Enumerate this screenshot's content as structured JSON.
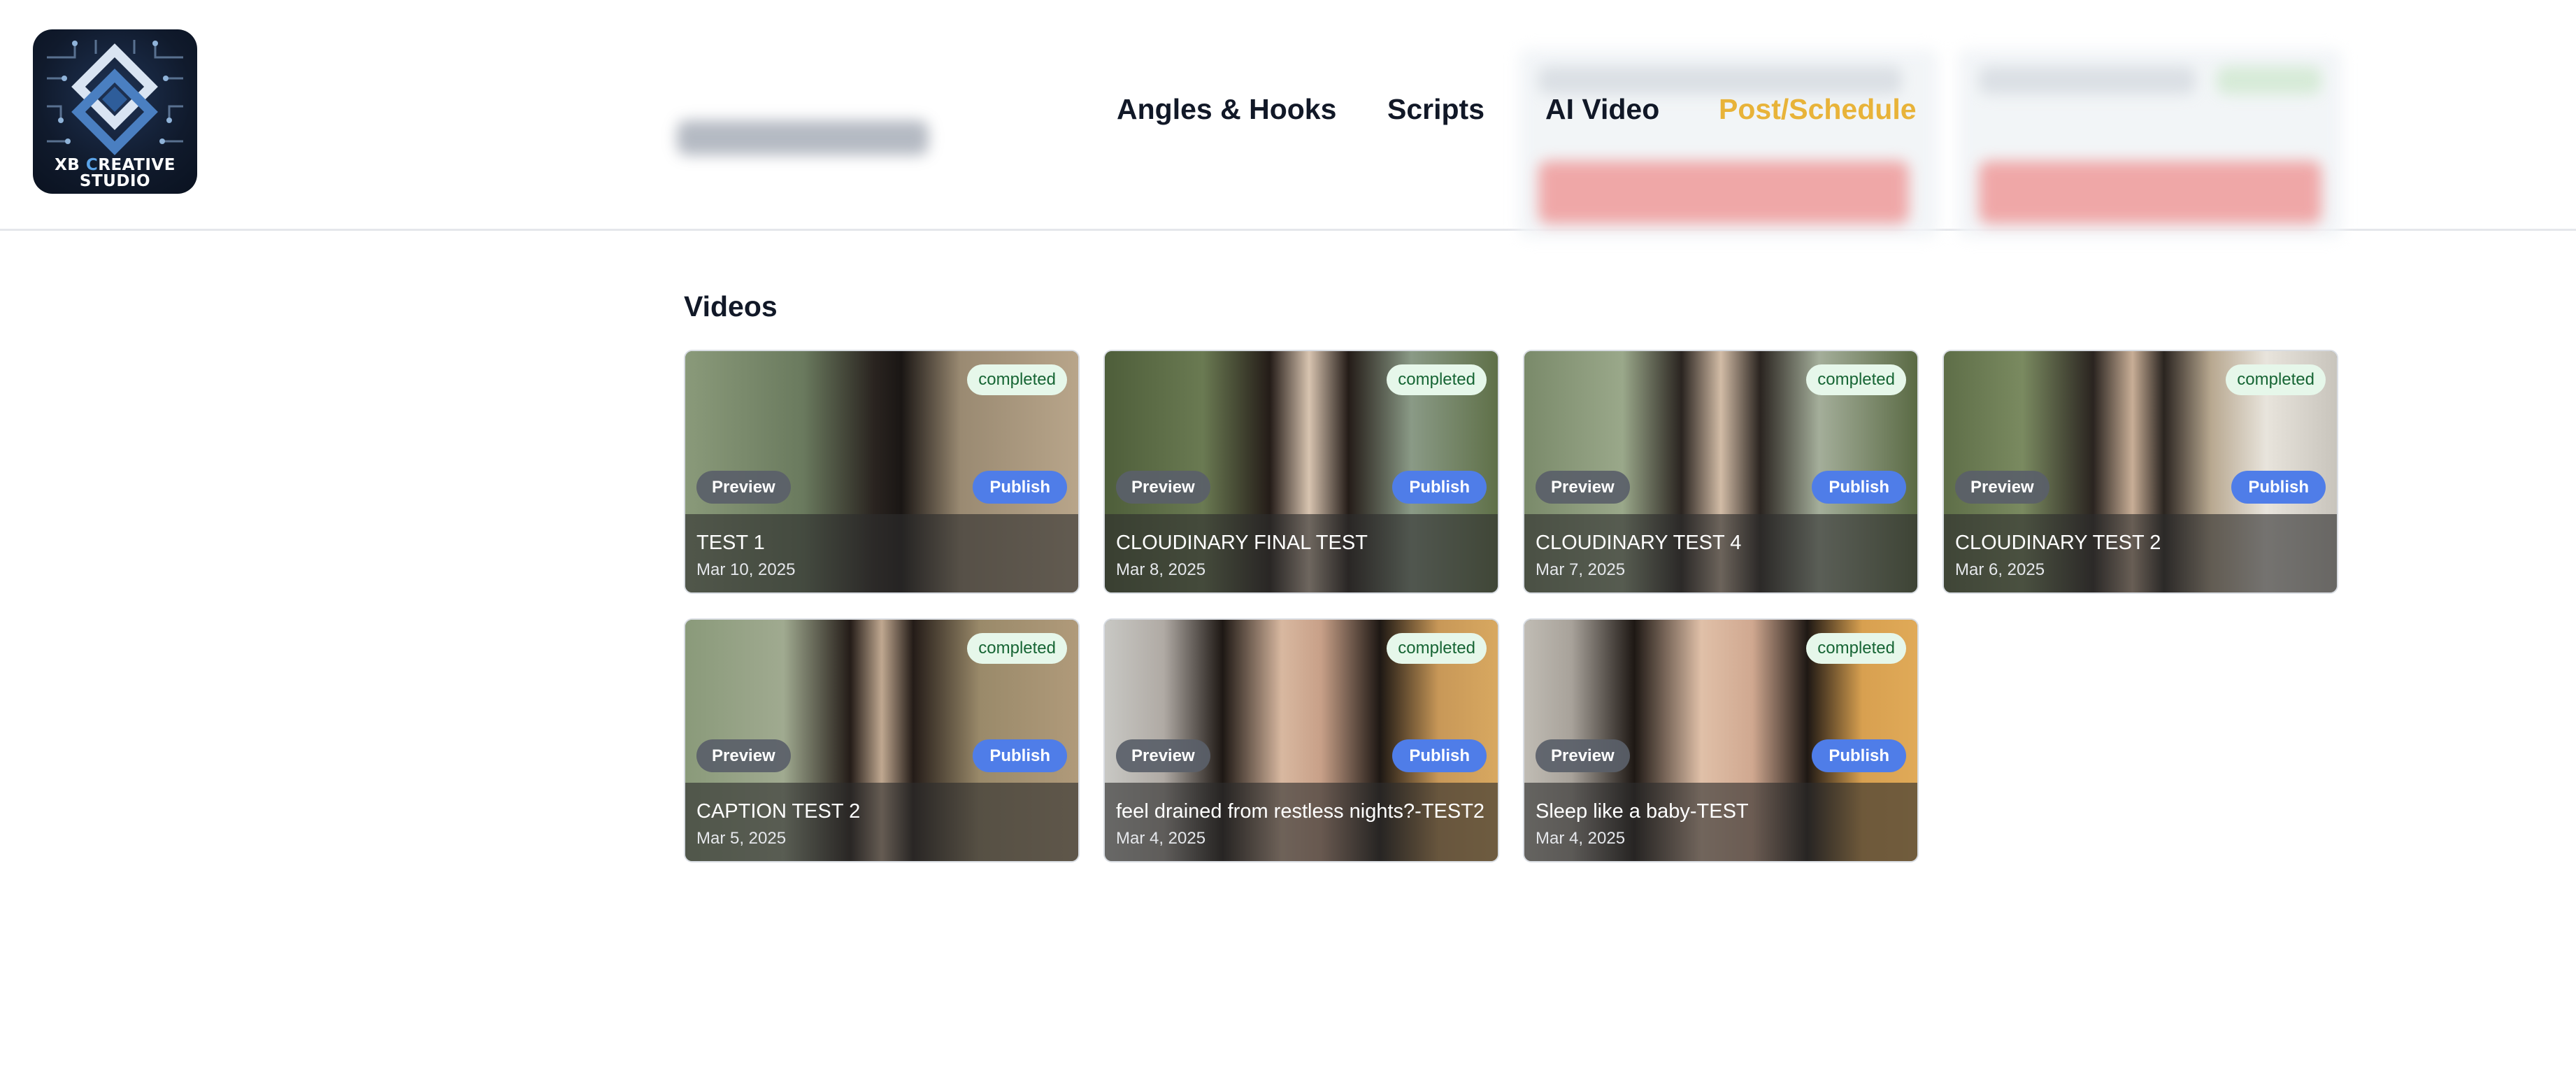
{
  "logo": {
    "line1_prefix": "XB ",
    "line1_accent": "C",
    "line1_rest": "REATIVE",
    "line2": "STUDIO"
  },
  "nav": {
    "items": [
      {
        "label": "Angles & Hooks",
        "active": false
      },
      {
        "label": "Scripts",
        "active": false
      },
      {
        "label": "AI Video",
        "active": false
      },
      {
        "label": "Post/Schedule",
        "active": true
      }
    ],
    "active_color": "#e8b339"
  },
  "main": {
    "section_title": "Videos",
    "preview_label": "Preview",
    "publish_label": "Publish",
    "videos": [
      {
        "title": "TEST 1",
        "date": "Mar 10, 2025",
        "status": "completed"
      },
      {
        "title": "CLOUDINARY FINAL TEST",
        "date": "Mar 8, 2025",
        "status": "completed"
      },
      {
        "title": "CLOUDINARY TEST 4",
        "date": "Mar 7, 2025",
        "status": "completed"
      },
      {
        "title": "CLOUDINARY TEST 2",
        "date": "Mar 6, 2025",
        "status": "completed"
      },
      {
        "title": "CAPTION TEST 2",
        "date": "Mar 5, 2025",
        "status": "completed"
      },
      {
        "title": "feel drained from restless nights?-TEST2",
        "date": "Mar 4, 2025",
        "status": "completed"
      },
      {
        "title": "Sleep like a baby-TEST",
        "date": "Mar 4, 2025",
        "status": "completed"
      }
    ]
  },
  "colors": {
    "publish": "#4f7de8",
    "badge_bg": "#e6f7ea",
    "badge_text": "#166534"
  }
}
